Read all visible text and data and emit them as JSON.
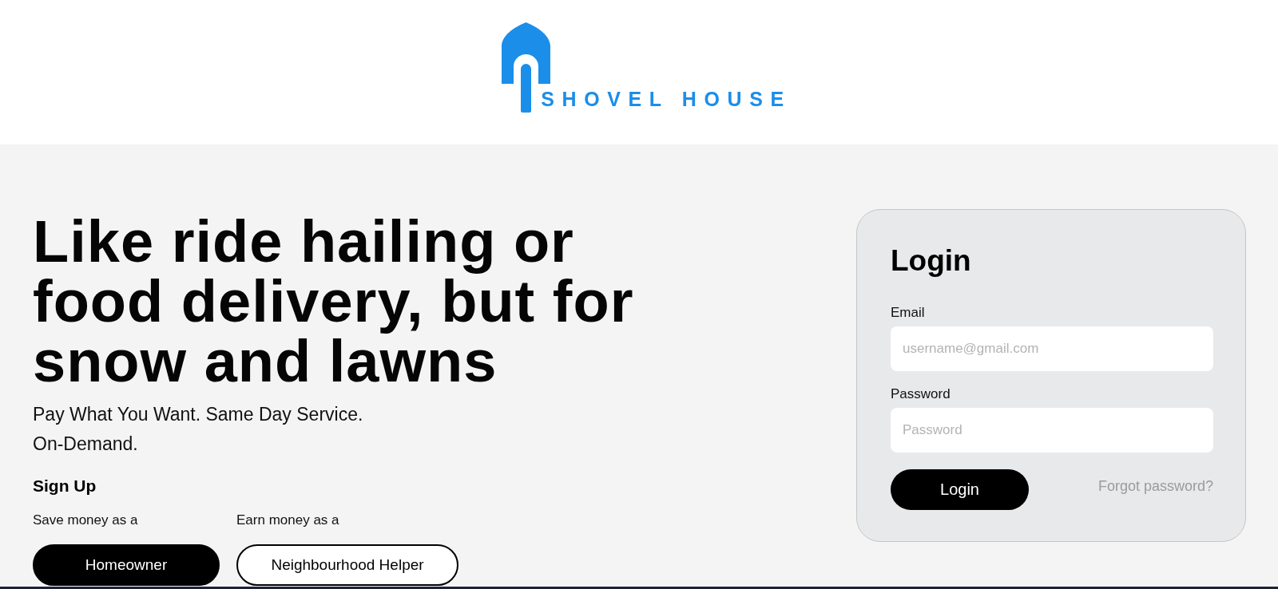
{
  "header": {
    "brand": "SHOVEL HOUSE"
  },
  "hero": {
    "headline": "Like ride hailing or food delivery, but for snow and lawns",
    "tagline": "Pay What You Want. Same Day Service. On-Demand."
  },
  "signup": {
    "title": "Sign Up",
    "options": [
      {
        "caption": "Save money as a",
        "button": "Homeowner",
        "kind": "filled"
      },
      {
        "caption": "Earn money as a",
        "button": "Neighbourhood Helper",
        "kind": "outline"
      }
    ]
  },
  "login": {
    "title": "Login",
    "fields": [
      {
        "label": "Email",
        "placeholder": "username@gmail.com"
      },
      {
        "label": "Password",
        "placeholder": "Password"
      }
    ],
    "submit": "Login",
    "forgot_link": "Forgot password?"
  }
}
